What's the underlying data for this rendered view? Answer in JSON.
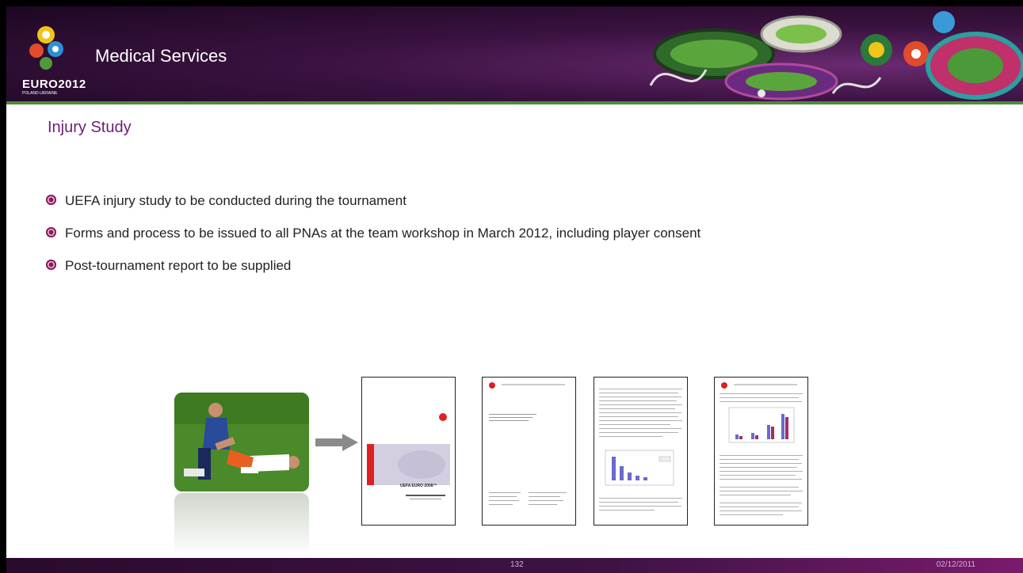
{
  "header": {
    "title": "Medical Services",
    "logo_text": "EURO2012",
    "logo_sub": "POLAND-UKRAINE"
  },
  "slide": {
    "title": "Injury Study",
    "bullets": [
      "UEFA injury study to be conducted during the tournament",
      "Forms and process to be issued to all PNAs at the team workshop in March 2012, including player consent",
      "Post-tournament report to be supplied"
    ]
  },
  "documents": {
    "cover_title": "UEFA EURO 2008™"
  },
  "footer": {
    "page_number": "132",
    "date": "02/12/2011"
  },
  "colors": {
    "header_bg": "#3a1240",
    "title_color": "#6d1f6f",
    "bullet_color": "#8a1b5e",
    "accent_green": "#4e8c3a"
  }
}
